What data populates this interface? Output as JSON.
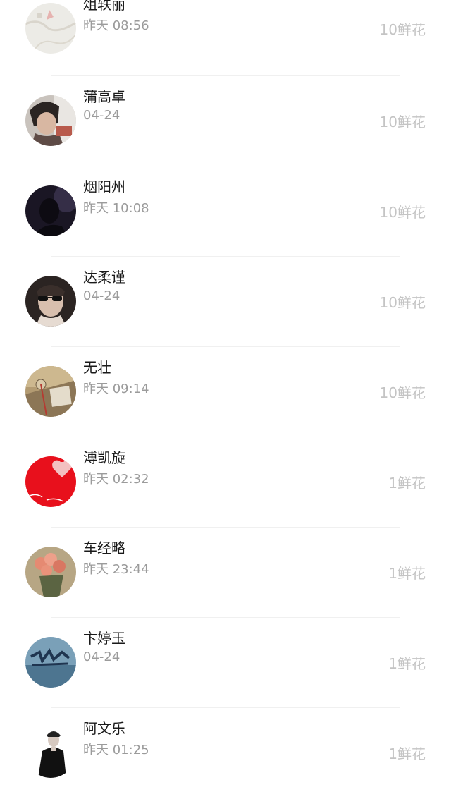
{
  "gift_list": [
    {
      "name": "俎轶丽",
      "time": "昨天 08:56",
      "gift": "10鲜花",
      "avatar_icon": "map-photo-avatar"
    },
    {
      "name": "蒲高卓",
      "time": "04-24",
      "gift": "10鲜花",
      "avatar_icon": "person-photo-avatar"
    },
    {
      "name": "烟阳州",
      "time": "昨天 10:08",
      "gift": "10鲜花",
      "avatar_icon": "dark-silhouette-avatar"
    },
    {
      "name": "达柔谨",
      "time": "04-24",
      "gift": "10鲜花",
      "avatar_icon": "kid-sunglasses-avatar"
    },
    {
      "name": "无壮",
      "time": "昨天 09:14",
      "gift": "10鲜花",
      "avatar_icon": "vintage-photo-avatar"
    },
    {
      "name": "溥凯旋",
      "time": "昨天 02:32",
      "gift": "1鲜花",
      "avatar_icon": "red-heart-avatar"
    },
    {
      "name": "车经略",
      "time": "昨天 23:44",
      "gift": "1鲜花",
      "avatar_icon": "flower-bouquet-avatar"
    },
    {
      "name": "卞婷玉",
      "time": "04-24",
      "gift": "1鲜花",
      "avatar_icon": "blue-art-avatar"
    },
    {
      "name": "阿文乐",
      "time": "昨天 01:25",
      "gift": "1鲜花",
      "avatar_icon": "man-black-coat-avatar"
    }
  ]
}
